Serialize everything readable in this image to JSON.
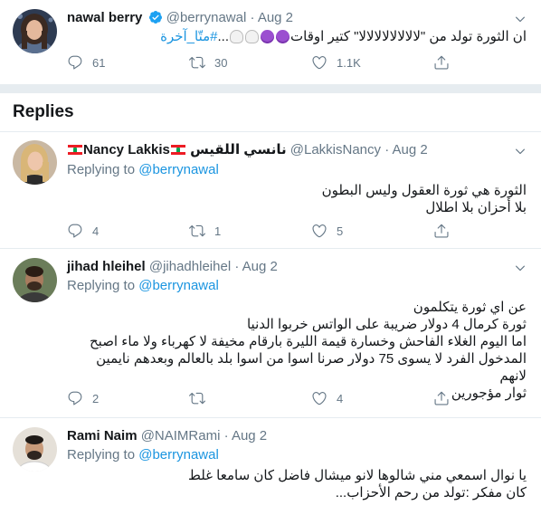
{
  "main_tweet": {
    "name": "nawal berry",
    "handle": "@berrynawal",
    "date": "Aug 2",
    "text_before": "ان الثورة تولد من \"لالالالالالالالا\" كتير اوقات",
    "emojis": [
      "devil",
      "devil",
      "ghost",
      "ghost"
    ],
    "text_mid": "...",
    "hashtag": "#متّا_آخرة",
    "replies": "61",
    "retweets": "30",
    "likes": "1.1K"
  },
  "replies_heading": "Replies",
  "replies": [
    {
      "name": "Nancy Lakkis",
      "name_ar": "نانسي اللقيس",
      "handle": "@LakkisNancy",
      "date": "Aug 2",
      "replying_prefix": "Replying to",
      "replying_to": "@berrynawal",
      "lines": [
        "الثورة هي ثورة العقول وليس البطون",
        "بلا أحزان بلا اطلال"
      ],
      "replies": "4",
      "retweets": "1",
      "likes": "5"
    },
    {
      "name": "jihad hleihel",
      "handle": "@jihadhleihel",
      "date": "Aug 2",
      "replying_prefix": "Replying to",
      "replying_to": "@berrynawal",
      "lines": [
        "عن اي ثورة يتكلمون",
        "ثورة كرمال 4 دولار ضريبة على الواتس خربوا الدنيا",
        "اما اليوم الغلاء الفاحش وخسارة قيمة الليرة بارقام مخيفة لا كهرباء ولا ماء اصبح",
        "المدخول الفرد لا يسوى 75 دولار صرنا اسوا من اسوا بلد بالعالم وبعدهم نايمين لانهم",
        "ثوار مؤجورين"
      ],
      "replies": "2",
      "retweets": "",
      "likes": "4"
    },
    {
      "name": "Rami Naim",
      "handle": "@NAIMRami",
      "date": "Aug 2",
      "replying_prefix": "Replying to",
      "replying_to": "@berrynawal",
      "lines": [
        "يا نوال اسمعي مني شالوها لانو ميشال فاضل كان سامعا غلط",
        "كان مفكر :تولد من رحم الأحزاب..."
      ],
      "replies": "",
      "retweets": "",
      "likes": ""
    }
  ]
}
